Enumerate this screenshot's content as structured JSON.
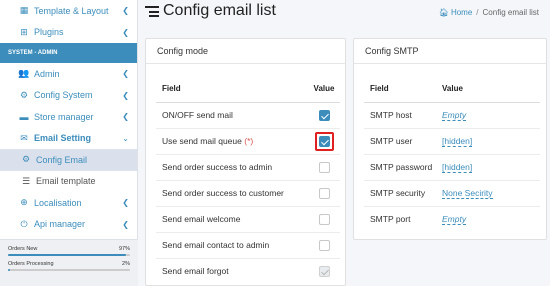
{
  "sidebar": {
    "items_top": [
      {
        "label": "Template & Layout",
        "icon": "template-icon"
      },
      {
        "label": "Plugins",
        "icon": "plugin-icon"
      }
    ],
    "section_header": "SYSTEM - ADMIN",
    "items": [
      {
        "label": "Admin",
        "icon": "users-icon"
      },
      {
        "label": "Config System",
        "icon": "gears-icon"
      },
      {
        "label": "Store manager",
        "icon": "store-icon"
      },
      {
        "label": "Email Setting",
        "icon": "envelope-icon"
      }
    ],
    "sub_items": [
      {
        "label": "Config Email",
        "icon": "gear-icon"
      },
      {
        "label": "Email template",
        "icon": "list-icon"
      }
    ],
    "items_bottom": [
      {
        "label": "Localisation",
        "icon": "globe-icon"
      },
      {
        "label": "Api manager",
        "icon": "plug-icon"
      }
    ],
    "stats": [
      {
        "label": "Orders New",
        "value": "97%",
        "fill": 0.97
      },
      {
        "label": "Orders Processing",
        "value": "2%",
        "fill": 0.02
      }
    ]
  },
  "header": {
    "title": "Config email list",
    "breadcrumb_home": "Home",
    "breadcrumb_sep": "/",
    "breadcrumb_current": "Config email list"
  },
  "config_mode": {
    "title": "Config mode",
    "col_field": "Field",
    "col_value": "Value",
    "rows": [
      {
        "label": "ON/OFF send mail",
        "required": "",
        "checked": true
      },
      {
        "label": "Use send mail queue",
        "required": "(*)",
        "checked": true
      },
      {
        "label": "Send order success to admin",
        "required": "",
        "checked": false
      },
      {
        "label": "Send order success to customer",
        "required": "",
        "checked": false
      },
      {
        "label": "Send email welcome",
        "required": "",
        "checked": false
      },
      {
        "label": "Send email contact to admin",
        "required": "",
        "checked": false
      },
      {
        "label": "Send email forgot",
        "required": "",
        "checked": true
      }
    ]
  },
  "config_smtp": {
    "title": "Config SMTP",
    "col_field": "Field",
    "col_value": "Value",
    "rows": [
      {
        "label": "SMTP host",
        "value": "Empty"
      },
      {
        "label": "SMTP user",
        "value": "[hidden]"
      },
      {
        "label": "SMTP password",
        "value": "[hidden]"
      },
      {
        "label": "SMTP security",
        "value": "None Secirity"
      },
      {
        "label": "SMTP port",
        "value": "Empty"
      }
    ]
  },
  "colors": {
    "accent": "#3c8dbc",
    "highlight": "#e02020"
  }
}
